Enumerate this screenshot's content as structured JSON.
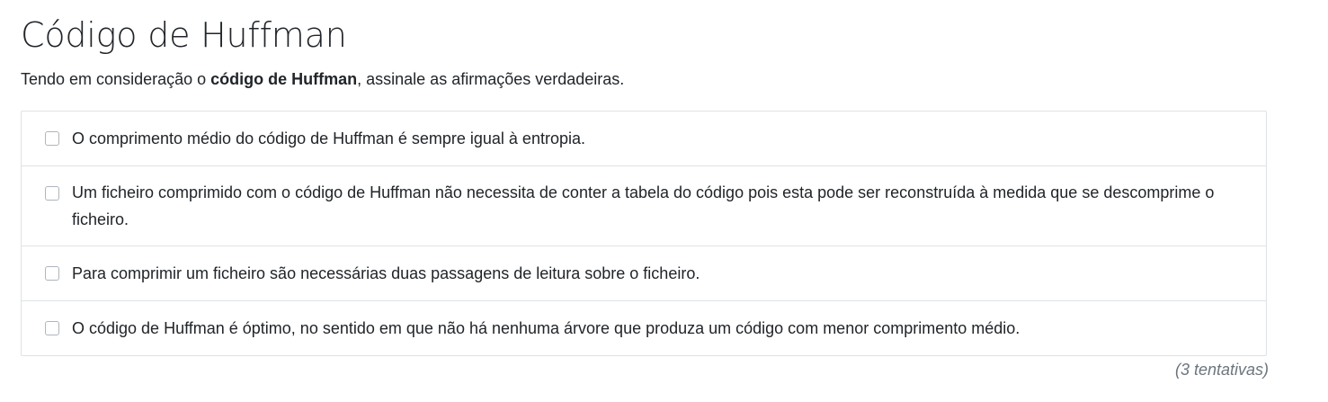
{
  "question": {
    "title": "Código de Huffman",
    "intro_before": "Tendo em consideração o ",
    "intro_bold": "código de Huffman",
    "intro_after": ", assinale as afirmações verdadeiras."
  },
  "options": [
    {
      "label": "O comprimento médio do código de Huffman é sempre igual à entropia.",
      "checked": false
    },
    {
      "label": "Um ficheiro comprimido com o código de Huffman não necessita de conter a tabela do código pois esta pode ser reconstruída à medida que se descomprime o ficheiro.",
      "checked": false
    },
    {
      "label": "Para comprimir um ficheiro são necessárias duas passagens de leitura sobre o ficheiro.",
      "checked": false
    },
    {
      "label": "O código de Huffman é óptimo, no sentido em que não há nenhuma árvore que produza um código com menor comprimento médio.",
      "checked": false
    }
  ],
  "attempts": "(3 tentativas)",
  "colors": {
    "text": "#212529",
    "border": "#dee2e6",
    "muted": "#6c757d"
  }
}
